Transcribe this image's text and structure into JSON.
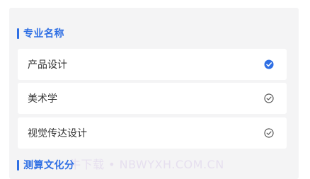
{
  "section_major": {
    "title": "专业名称"
  },
  "options": [
    {
      "label": "产品设计",
      "selected": true
    },
    {
      "label": "美术学",
      "selected": false
    },
    {
      "label": "视觉传达设计",
      "selected": false
    }
  ],
  "section_score": {
    "title": "测算文化分"
  },
  "watermark": "牛下载 • NBWYXH.COM.CN",
  "colors": {
    "accent": "#2f6fe4",
    "panel_bg": "#f4f4f5",
    "card_bg": "#ffffff",
    "text": "#333333",
    "unchecked_icon": "#555555"
  },
  "icons": {
    "selected": "check-circle-filled-icon",
    "unselected": "check-circle-outline-icon"
  }
}
